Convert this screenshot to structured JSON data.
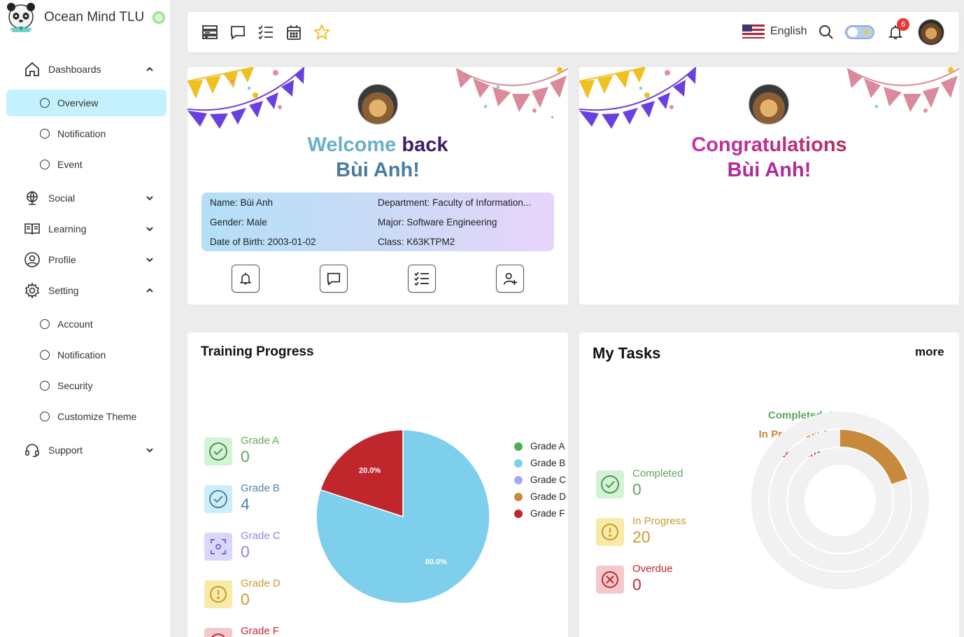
{
  "brand": {
    "name": "Ocean Mind TLU"
  },
  "sidebar": {
    "dashboards": "Dashboards",
    "overview": "Overview",
    "notification": "Notification",
    "event": "Event",
    "social": "Social",
    "learning": "Learning",
    "profile": "Profile",
    "setting": "Setting",
    "account": "Account",
    "setting_notification": "Notification",
    "security": "Security",
    "customize_theme": "Customize Theme",
    "support": "Support"
  },
  "topbar": {
    "language": "English",
    "notification_count": "6"
  },
  "welcome": {
    "line1_a": "Welcome",
    "line1_b": "back",
    "line2": "Bùi Anh!",
    "name": "Name: Bùi Anh",
    "gender": "Gender: Male",
    "dob": "Date of Birth: 2003-01-02",
    "department": "Department: Faculty of Information...",
    "major": "Major: Software Engineering",
    "class": "Class: K63KTPM2"
  },
  "congrats": {
    "line1": "Congratulations",
    "line2": "Bùi Anh!"
  },
  "training": {
    "title": "Training Progress",
    "grades": [
      {
        "name": "Grade A",
        "value": "0"
      },
      {
        "name": "Grade B",
        "value": "4"
      },
      {
        "name": "Grade C",
        "value": "0"
      },
      {
        "name": "Grade D",
        "value": "0"
      },
      {
        "name": "Grade F",
        "value": ""
      }
    ]
  },
  "tasks": {
    "title": "My Tasks",
    "more": "more",
    "completed_label": "Completed",
    "completed_value": "0",
    "inprogress_label": "In Progress",
    "inprogress_value": "20",
    "overdue_label": "Overdue",
    "overdue_value": "0",
    "radial_completed": "Completed: 0",
    "radial_inprogress": "In Progress: 20",
    "radial_overdue": "Overdue: 0"
  },
  "colors": {
    "gradeA": "#4caf50",
    "gradeB": "#7ecfeb",
    "gradeC": "#a9a7f3",
    "gradeD": "#c8893c",
    "gradeF": "#c0272d"
  },
  "chart_data": [
    {
      "type": "pie",
      "categories": [
        "Grade A",
        "Grade B",
        "Grade C",
        "Grade D",
        "Grade F"
      ],
      "values": [
        0,
        80.0,
        0,
        0,
        20.0
      ],
      "labels": [
        "",
        "80.0%",
        "",
        "",
        "20.0%"
      ],
      "legend": "right"
    },
    {
      "type": "bar",
      "categories": [
        "Completed",
        "In Progress",
        "Overdue"
      ],
      "values": [
        0,
        20,
        0
      ]
    }
  ]
}
